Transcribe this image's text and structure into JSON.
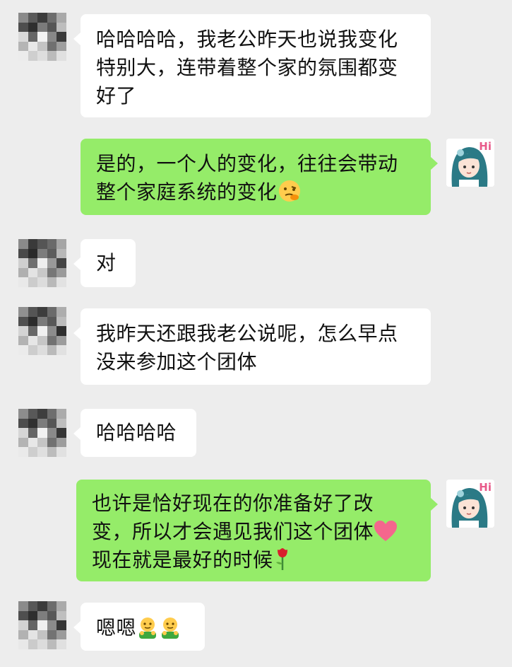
{
  "messages": [
    {
      "side": "in",
      "lines": [
        "哈哈哈哈，我老公昨天也说我变化",
        "特别大，连带着整个家的氛围都变",
        "好了"
      ]
    },
    {
      "side": "out",
      "lines": [
        "是的，一个人的变化，往往会带动",
        "整个家庭系统的变化"
      ],
      "emoji": "thinking-face"
    },
    {
      "side": "in",
      "lines": [
        "对"
      ]
    },
    {
      "side": "in",
      "lines": [
        "我昨天还跟我老公说呢，怎么早点",
        "没来参加这个团体"
      ]
    },
    {
      "side": "in",
      "lines": [
        "哈哈哈哈"
      ]
    },
    {
      "side": "out",
      "lines": [
        "也许是恰好现在的你准备好了改",
        "变，所以才会遇见我们这个团体",
        "现在就是最好的时候"
      ],
      "emoji": [
        "heart",
        "rose"
      ]
    },
    {
      "side": "in",
      "lines": [
        "嗯嗯"
      ],
      "emoji": [
        "hug-person",
        "hug-person"
      ]
    }
  ],
  "self_avatar": {
    "badge": "Hi",
    "icon": "girl-teal-hair-avatar"
  },
  "colors": {
    "background": "#ededed",
    "incoming_bubble": "#ffffff",
    "outgoing_bubble": "#95ec69"
  }
}
